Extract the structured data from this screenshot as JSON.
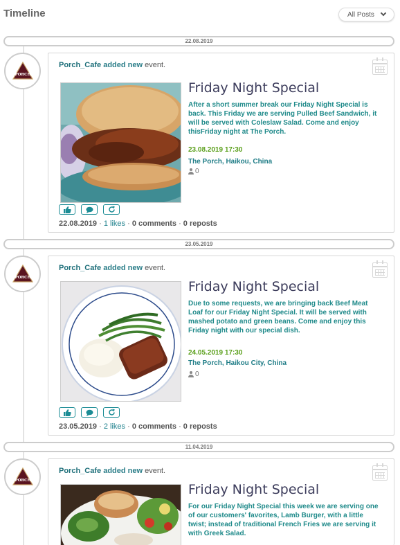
{
  "header": {
    "title": "Timeline",
    "filter_label": "All Posts"
  },
  "posts": [
    {
      "date_bar": "22.08.2019",
      "author": "Porch_Cafe",
      "verb": "added new",
      "object": "event.",
      "title": "Friday Night Special",
      "description": "After a short summer break our Friday Night Special is back. This Friday we are serving Pulled Beef Sandwich, it will be served with Coleslaw Salad. Come and enjoy thisFriday night at The Porch.",
      "event_datetime": "23.08.2019 17:30",
      "location": "The Porch, Haikou, China",
      "attendees": "0",
      "post_date": "22.08.2019",
      "likes": "1 likes",
      "comments": "0 comments",
      "reposts": "0 reposts",
      "image": "pulled-beef-sandwich"
    },
    {
      "date_bar": "23.05.2019",
      "author": "Porch_Cafe",
      "verb": "added new",
      "object": "event.",
      "title": "Friday Night Special",
      "description": "Due to some requests, we are bringing back Beef Meat Loaf for our Friday Night Special. It will be served with mashed potato and green beans. Come and enjoy this Friday night with our special dish.",
      "event_datetime": "24.05.2019 17:30",
      "location": "The Porch, Haikou City, China",
      "attendees": "0",
      "post_date": "23.05.2019",
      "likes": "2 likes",
      "comments": "0 comments",
      "reposts": "0 reposts",
      "image": "meat-loaf-plate"
    },
    {
      "date_bar": "11.04.2019",
      "author": "Porch_Cafe",
      "verb": "added new",
      "object": "event.",
      "title": "Friday Night Special",
      "description": "For our Friday Night Special this week we are serving one of our customers' favorites, Lamb Burger, with a little twist; instead of traditional French Fries we are serving it with Greek Salad.",
      "image": "lamb-burger-plate"
    }
  ],
  "icons": {
    "like": "thumbs-up-icon",
    "comment": "comment-icon",
    "repost": "repost-icon",
    "calendar": "calendar-icon",
    "attendees": "user-icon",
    "filter": "chevron-down-icon"
  },
  "colors": {
    "accent": "#1b8c95",
    "date": "#5a9f1a",
    "title": "#3d3d5c"
  }
}
